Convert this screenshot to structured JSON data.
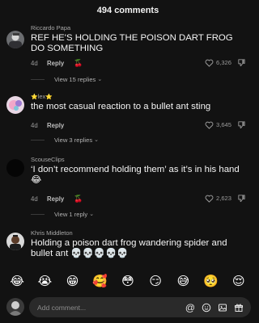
{
  "header": {
    "title": "494 comments"
  },
  "comments": [
    {
      "username": "Riccardo Papa",
      "text": "REF HE'S HOLDING THE POISON DART FROG DO SOMETHING",
      "age": "4d",
      "reply_label": "Reply",
      "creator_liked": "🍒",
      "likes": "6,326",
      "replies_label": "View 15 replies"
    },
    {
      "username_prefix_star": "⭐",
      "username": "lex",
      "username_suffix_star": "⭐",
      "text": "the most casual reaction to a bullet ant sting",
      "age": "4d",
      "reply_label": "Reply",
      "likes": "3,645",
      "replies_label": "View 3 replies"
    },
    {
      "username": "ScouseClips",
      "text": "‘I don’t recommend holding them’ as it’s in his hand 😂",
      "age": "4d",
      "reply_label": "Reply",
      "creator_liked": "🍒",
      "likes": "2,623",
      "replies_label": "View 1 reply"
    },
    {
      "username": "Khris Middleton",
      "text": "Holding a poison dart frog wandering spider and bullet ant 💀💀💀💀💀"
    }
  ],
  "emoji_bar": [
    "😂",
    "😭",
    "😁",
    "🥰",
    "😳",
    "😏",
    "😅",
    "🥺",
    "😌"
  ],
  "input": {
    "placeholder": "Add comment...",
    "mention": "@",
    "emoji": "☺",
    "image": "▣",
    "gift": "🎁"
  },
  "icons": {
    "heart": "heart-outline-icon",
    "dislike": "dislike-icon",
    "chevron": "chevron-down-icon"
  }
}
